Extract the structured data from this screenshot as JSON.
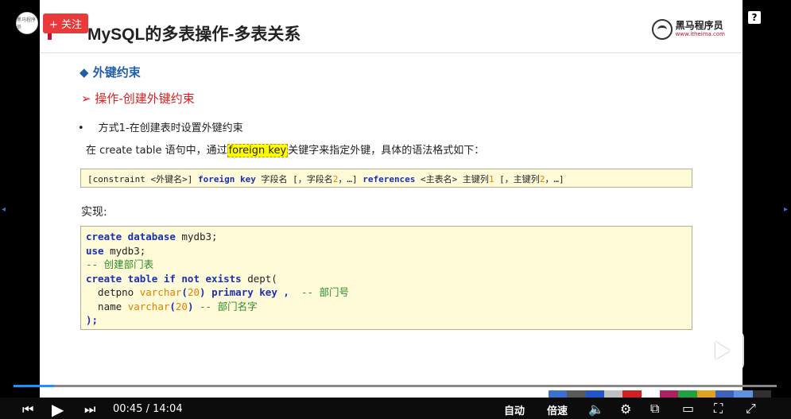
{
  "slide": {
    "title": "MySQL的多表操作-多表关系",
    "logo_cn": "黑马程序员",
    "logo_url": "www.itheima.com",
    "bullet1": "◆ 外键约束",
    "bullet2": "➢ 操作-创建外键约束",
    "bullet3_dot": "•",
    "bullet3": "方式1-在创建表时设置外键约束",
    "line4_pre": "在 create table 语句中，通过",
    "line4_hl": "foreign key",
    "line4_post": "关键字来指定外键，具体的语法格式如下：",
    "syntax": {
      "p1": "[constraint <外键名>] ",
      "p2": "foreign key",
      "p3": " 字段名 [，字段名",
      "p4": "2",
      "p5": "，…] ",
      "p6": "references",
      "p7": " <主表名> 主键列",
      "p8": "1",
      "p9": " [，主键列",
      "p10": "2",
      "p11": "，…]"
    },
    "impl_label": "实现:",
    "code": {
      "l1_kw": "create database",
      "l1_rest": " mydb3;",
      "l2_kw": "use",
      "l2_rest": " mydb3;",
      "l3": "-- 创建部门表",
      "l4_kw": "create table if not exists",
      "l4_rest": " dept(",
      "l5_a": "  detpno ",
      "l5_type": "varchar",
      "l5_p1": "(",
      "l5_num": "20",
      "l5_p2": ") ",
      "l5_kw": "primary key",
      "l5_c": " ,  ",
      "l5_cm": "-- 部门号",
      "l6_a": "  name ",
      "l6_type": "varchar",
      "l6_p1": "(",
      "l6_num": "20",
      "l6_p2": ") ",
      "l6_cm": "-- 部门名字",
      "l7": ");"
    }
  },
  "player": {
    "follow_label": "+ 关注",
    "avatar_text": "黑马程序员",
    "help": "?",
    "time_current": "00:45",
    "time_sep": " / ",
    "time_total": "14:04",
    "auto_label": "自动",
    "speed_label": "倍速",
    "progress_fraction": 0.053,
    "accent_color": "#1e90ff"
  }
}
